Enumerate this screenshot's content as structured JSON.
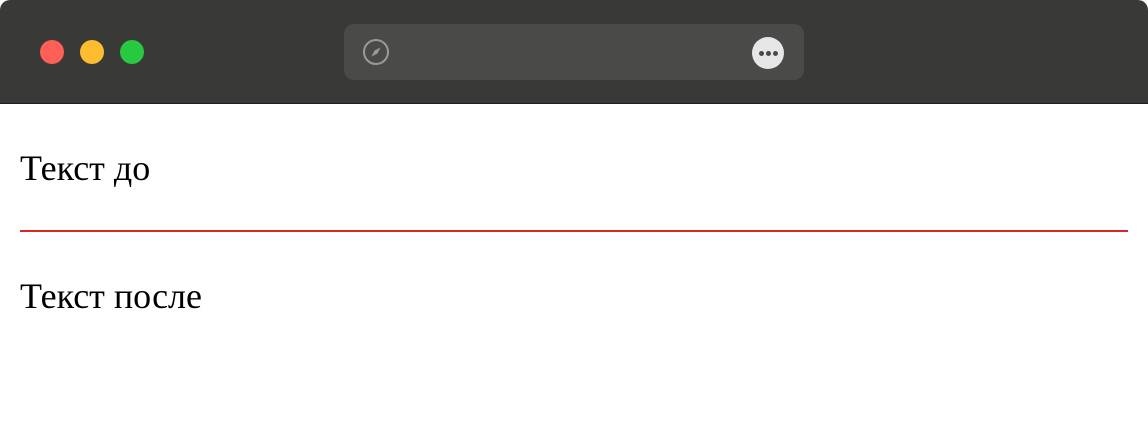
{
  "window": {
    "traffic_lights": {
      "close_color": "#ff5f57",
      "minimize_color": "#febc2e",
      "zoom_color": "#28c840"
    },
    "address_bar": {
      "url_text": "",
      "icons": [
        "compass-icon",
        "more-icon"
      ]
    }
  },
  "page": {
    "text_before": "Текст до",
    "text_after": "Текст после",
    "divider_color": "#dc2626"
  }
}
